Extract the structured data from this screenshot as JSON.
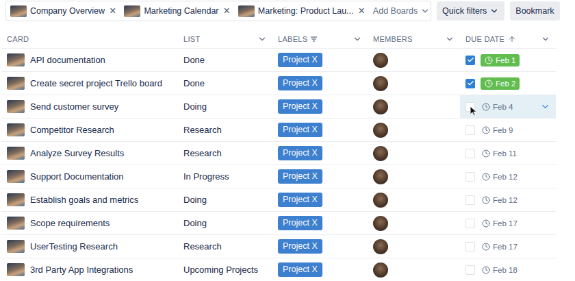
{
  "tabs": [
    {
      "label": "Company Overview",
      "close": "×"
    },
    {
      "label": "Marketing Calendar",
      "close": "×"
    },
    {
      "label": "Marketing: Product Lau...",
      "close": "×"
    }
  ],
  "add_boards": {
    "label": "Add Boards"
  },
  "buttons": [
    {
      "label": "Quick filters",
      "menu": true
    },
    {
      "label": "Bookmark",
      "menu": false
    }
  ],
  "table": {
    "columns": [
      {
        "label": "CARD",
        "menu": false,
        "filter": false,
        "sorted": false
      },
      {
        "label": "LIST",
        "menu": true,
        "filter": false,
        "sorted": false
      },
      {
        "label": "LABELS",
        "menu": true,
        "filter": true,
        "sorted": false
      },
      {
        "label": "MEMBERS",
        "menu": true,
        "filter": false,
        "sorted": false
      },
      {
        "label": "DUE DATE",
        "menu": true,
        "filter": false,
        "sorted": true
      }
    ],
    "rows": [
      {
        "card": "API documentation",
        "list": "Done",
        "label": {
          "text": "Project X",
          "color": "#3d80cf"
        },
        "due": "Feb 1",
        "complete": true,
        "hovered": false
      },
      {
        "card": "Create secret project Trello board",
        "list": "Done",
        "label": {
          "text": "Project X",
          "color": "#3d80cf"
        },
        "due": "Feb 2",
        "complete": true,
        "hovered": false
      },
      {
        "card": "Send customer survey",
        "list": "Doing",
        "label": {
          "text": "Project X",
          "color": "#3d80cf"
        },
        "due": "Feb 4",
        "complete": false,
        "hovered": true
      },
      {
        "card": "Competitor Research",
        "list": "Research",
        "label": {
          "text": "Project X",
          "color": "#3d80cf"
        },
        "due": "Feb 9",
        "complete": false,
        "hovered": false
      },
      {
        "card": "Analyze Survey Results",
        "list": "Research",
        "label": {
          "text": "Project X",
          "color": "#3d80cf"
        },
        "due": "Feb 11",
        "complete": false,
        "hovered": false
      },
      {
        "card": "Support Documentation",
        "list": "In Progress",
        "label": {
          "text": "Project X",
          "color": "#3d80cf"
        },
        "due": "Feb 12",
        "complete": false,
        "hovered": false
      },
      {
        "card": "Establish goals and metrics",
        "list": "Doing",
        "label": {
          "text": "Project X",
          "color": "#3d80cf"
        },
        "due": "Feb 12",
        "complete": false,
        "hovered": false
      },
      {
        "card": "Scope requirements",
        "list": "Doing",
        "label": {
          "text": "Project X",
          "color": "#3d80cf"
        },
        "due": "Feb 17",
        "complete": false,
        "hovered": false
      },
      {
        "card": "UserTesting Research",
        "list": "Research",
        "label": {
          "text": "Project X",
          "color": "#3d80cf"
        },
        "due": "Feb 17",
        "complete": false,
        "hovered": false
      },
      {
        "card": "3rd Party App Integrations",
        "list": "Upcoming Projects",
        "label": {
          "text": "Project X",
          "color": "#3d80cf"
        },
        "due": "Feb 18",
        "complete": false,
        "hovered": false
      }
    ]
  }
}
